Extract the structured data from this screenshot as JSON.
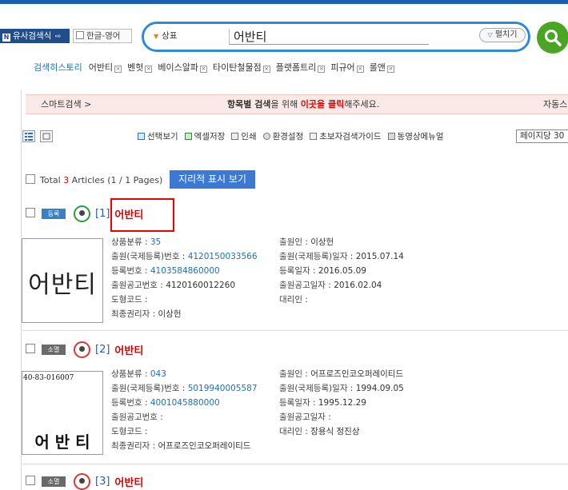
{
  "header": {
    "similar_search_label": "유사검색식",
    "ko_en_label": "한글-영어",
    "field_select": "상표",
    "search_value": "어반티",
    "expand_label": "펼치기"
  },
  "history": {
    "label": "검색히스토리",
    "items": [
      "어반티",
      "벤헛",
      "베이스알파",
      "타이탄철물점",
      "플랫폼트리",
      "피규어",
      "롤앤"
    ]
  },
  "smart_search": {
    "left": "스마트검색 >",
    "mid_pre": "항목별 검색",
    "mid_mid": "을 위해 ",
    "mid_red": "이곳을 클릭",
    "mid_post": "해주세요.",
    "right": "자동스"
  },
  "toolbar": {
    "tools": [
      "선택보기",
      "엑셀저장",
      "인쇄",
      "환경설정",
      "초보자검색가이드",
      "동영상메뉴얼"
    ],
    "per_page": "페이지당 30"
  },
  "summary": {
    "total_pre": "Total ",
    "total_num": "3",
    "total_post": " Articles (1 / 1 Pages)",
    "map_button": "지리적 표시 보기"
  },
  "records": [
    {
      "badge": "등록",
      "index": "[1]",
      "title": "어반티",
      "image_text": "어반티",
      "left_fields": [
        {
          "label": "상품분류 : ",
          "value": "35"
        },
        {
          "label": "출원(국제등록)번호 : ",
          "value": "4120150033566"
        },
        {
          "label": "등록번호 : ",
          "value": "4103584860000"
        },
        {
          "label": "출원공고번호 : ",
          "value": "4120160012260"
        },
        {
          "label": "도형코드 : ",
          "value": ""
        },
        {
          "label": "최종권리자 : ",
          "value": "이상헌"
        }
      ],
      "right_fields": [
        {
          "label": "출원인 : ",
          "value": "이상헌"
        },
        {
          "label": "출원(국제등록)일자 : ",
          "value": "2015.07.14"
        },
        {
          "label": "등록일자 : ",
          "value": "2016.05.09"
        },
        {
          "label": "출원공고일자 : ",
          "value": "2016.02.04"
        },
        {
          "label": "대리인 : ",
          "value": ""
        }
      ]
    },
    {
      "badge": "소멸",
      "index": "[2]",
      "title": "어반티",
      "image_code": "40-83-016007",
      "image_text": "어 반 티",
      "left_fields": [
        {
          "label": "상품분류 : ",
          "value": "043"
        },
        {
          "label": "출원(국제등록)번호 : ",
          "value": "5019940005587"
        },
        {
          "label": "등록번호 : ",
          "value": "4001045880000"
        },
        {
          "label": "출원공고번호 : ",
          "value": ""
        },
        {
          "label": "도형코드 : ",
          "value": ""
        },
        {
          "label": "최종권리자 : ",
          "value": "어프로즈인코오퍼레이티드"
        }
      ],
      "right_fields": [
        {
          "label": "출원인 : ",
          "value": "어프로즈인코오퍼레이티드"
        },
        {
          "label": "출원(국제등록)일자 : ",
          "value": "1994.09.05"
        },
        {
          "label": "등록일자 : ",
          "value": "1995.12.29"
        },
        {
          "label": "출원공고일자 : ",
          "value": ""
        },
        {
          "label": "대리인 : ",
          "value": "장용식 정진상"
        }
      ]
    },
    {
      "badge": "소멸",
      "index": "[3]",
      "title": "어반티"
    }
  ],
  "colors": {
    "accent": "#2f8ad8",
    "search_go": "#4aa524",
    "title_red": "#dd0000",
    "link_blue": "#1f6fb8"
  }
}
